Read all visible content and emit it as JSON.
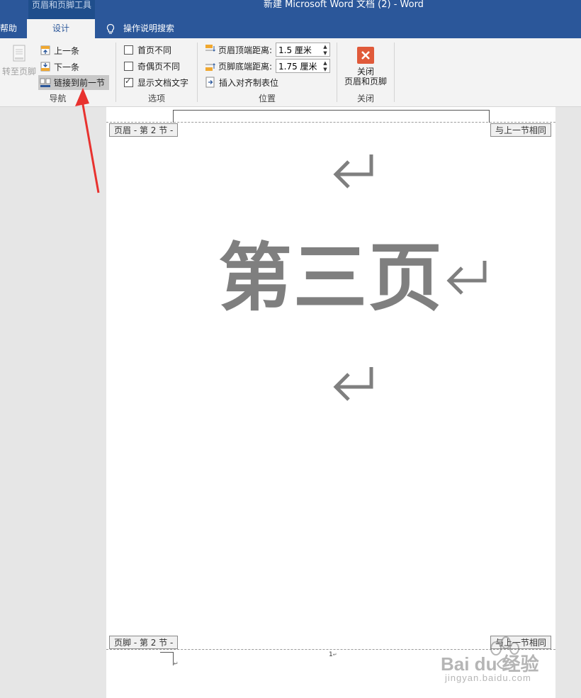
{
  "window": {
    "contextual_tab": "页眉和页脚工具",
    "title": "新建 Microsoft Word 文档 (2)  -  Word"
  },
  "tabs": {
    "help": "帮助",
    "design": "设计",
    "search": "操作说明搜索"
  },
  "ribbon": {
    "navigation": {
      "label": "导航",
      "goto_footer": "转至页脚",
      "previous": "上一条",
      "next": "下一条",
      "link_to_previous": "链接到前一节"
    },
    "options": {
      "label": "选项",
      "different_first_page": "首页不同",
      "different_odd_even": "奇偶页不同",
      "show_document_text": "显示文档文字",
      "different_first_page_checked": false,
      "different_odd_even_checked": false,
      "show_document_text_checked": true
    },
    "position": {
      "label": "位置",
      "header_from_top_label": "页眉顶端距离:",
      "header_from_top_value": "1.5 厘米",
      "footer_from_bottom_label": "页脚底端距离:",
      "footer_from_bottom_value": "1.75 厘米",
      "insert_alignment_tab": "插入对齐制表位"
    },
    "close": {
      "label": "关闭",
      "close_button_line1": "关闭",
      "close_button_line2": "页眉和页脚"
    }
  },
  "document": {
    "header_tag": "页眉 - 第 2 节 -",
    "header_same_as_previous": "与上一节相同",
    "body_text": "第三页",
    "footer_tag": "页脚 - 第 2 节 -",
    "footer_same_as_previous": "与上一节相同",
    "page_number": "1"
  },
  "watermark": {
    "brand": "Bai du 经验",
    "url": "jingyan.baidu.com"
  },
  "colors": {
    "title_bar": "#2b579a",
    "ribbon_bg": "#f3f3f3",
    "annotation_arrow": "#e8322f",
    "close_icon": "#e05a3a"
  }
}
